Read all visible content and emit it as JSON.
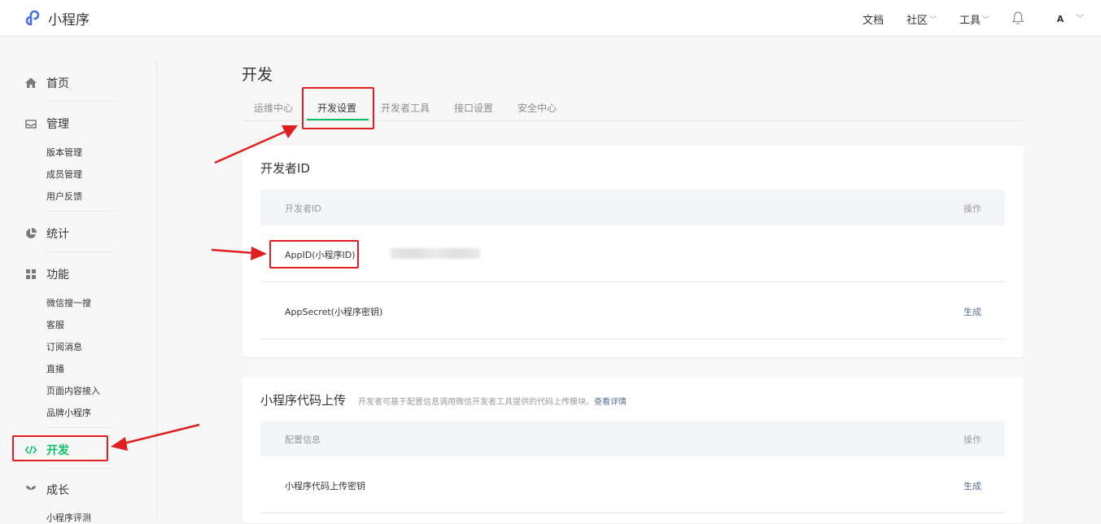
{
  "header": {
    "logo_text": "小程序",
    "nav": [
      "文档",
      "社区",
      "工具"
    ],
    "avatar_text": "A"
  },
  "sidebar": {
    "home": "首页",
    "manage": "管理",
    "manage_items": [
      "版本管理",
      "成员管理",
      "用户反馈"
    ],
    "stats": "统计",
    "features": "功能",
    "feature_items": [
      "微信搜一搜",
      "客服",
      "订阅消息",
      "直播",
      "页面内容接入",
      "品牌小程序"
    ],
    "dev": "开发",
    "growth": "成长",
    "growth_item_partial": "小程序评测"
  },
  "main": {
    "title": "开发",
    "tabs": [
      "运维中心",
      "开发设置",
      "开发者工具",
      "接口设置",
      "安全中心"
    ],
    "developer_card": {
      "title": "开发者ID",
      "col_name": "开发者ID",
      "col_action": "操作",
      "rows": [
        {
          "label": "AppID(小程序ID)",
          "action": ""
        },
        {
          "label": "AppSecret(小程序密钥)",
          "action": "生成"
        }
      ]
    },
    "upload_card": {
      "title": "小程序代码上传",
      "desc": "开发者可基于配置信息调用微信开发者工具提供的代码上传模块。",
      "desc_link": "查看详情",
      "col_name": "配置信息",
      "col_action": "操作",
      "rows": [
        {
          "label": "小程序代码上传密钥",
          "action": "生成"
        }
      ]
    }
  },
  "colors": {
    "accent": "#07c160",
    "highlight": "#e02020",
    "link": "#576b95"
  }
}
